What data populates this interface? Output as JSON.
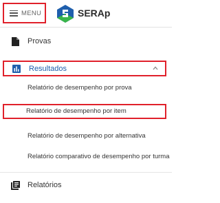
{
  "header": {
    "menu_label": "MENU",
    "brand": "SERAp",
    "colors": {
      "logo_blue": "#1f5fad",
      "logo_green": "#39b54a",
      "highlight": "#e0202a"
    }
  },
  "nav": {
    "provas": {
      "label": "Provas",
      "icon": "document-icon"
    },
    "resultados": {
      "label": "Resultados",
      "icon": "bar-chart-icon",
      "expanded": true,
      "sub_items": [
        "Relatório de desempenho por prova",
        "Relatório de desempenho por item",
        "Relatório de desempenho por alternativa",
        "Relatório comparativo de desempenho por turma"
      ]
    },
    "relatorios": {
      "label": "Relatórios",
      "icon": "library-books-icon"
    }
  }
}
